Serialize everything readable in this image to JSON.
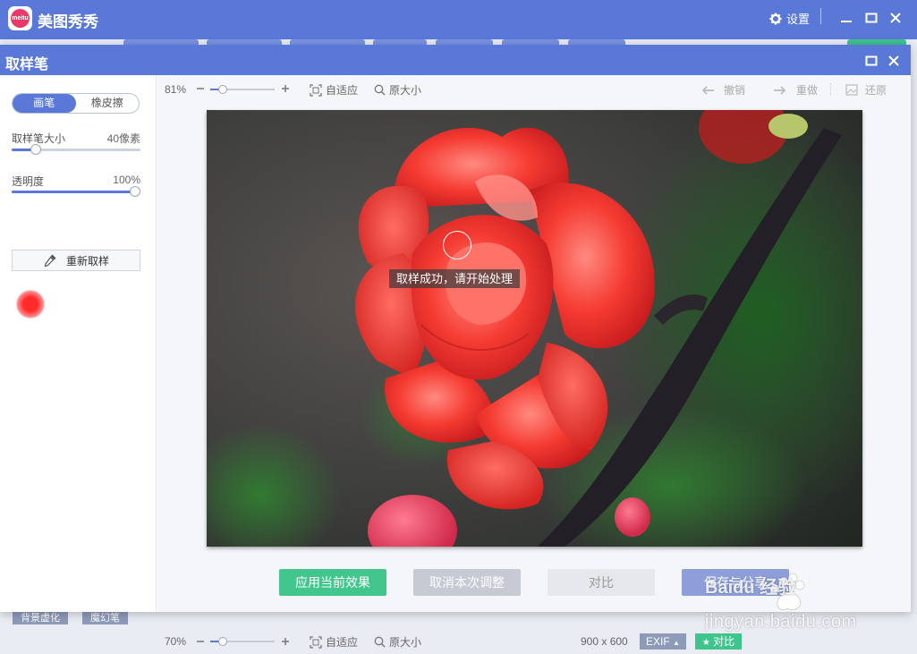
{
  "app": {
    "title": "美图秀秀",
    "logo_text": "meitu",
    "settings_label": "设置",
    "settings_icon": "gear-icon",
    "brand_color": "#5a78d8"
  },
  "dialog": {
    "title": "取样笔"
  },
  "left_panel": {
    "tabs": [
      {
        "label": "画笔",
        "active": true
      },
      {
        "label": "橡皮擦",
        "active": false
      }
    ],
    "brush_size": {
      "label": "取样笔大小",
      "value_text": "40像素",
      "level": 0.19
    },
    "opacity": {
      "label": "透明度",
      "value_text": "100%",
      "level": 1.0
    },
    "resample_label": "重新取样",
    "sampled_color": "#ff2a2a"
  },
  "toolbar": {
    "zoom": "81%",
    "zoom_level": 0.2,
    "fit_label": "自适应",
    "original_label": "原大小",
    "undo_label": "撤销",
    "redo_label": "重做",
    "restore_label": "还原"
  },
  "canvas": {
    "toast": "取样成功，请开始处理"
  },
  "actions": {
    "apply": "应用当前效果",
    "cancel": "取消本次调整",
    "compare": "对比",
    "save_share": "保存与分享"
  },
  "background_buttons": [
    "背景虚化",
    "魔幻笔"
  ],
  "bottom_bar": {
    "zoom": "70%",
    "zoom_level": 0.2,
    "fit_label": "自适应",
    "original_label": "原大小",
    "image_size": "900 x 600",
    "exif_label": "EXIF",
    "compare_label": "对比"
  },
  "watermark": {
    "brand": "Baidu 经验",
    "url": "jingyan.baidu.com"
  }
}
